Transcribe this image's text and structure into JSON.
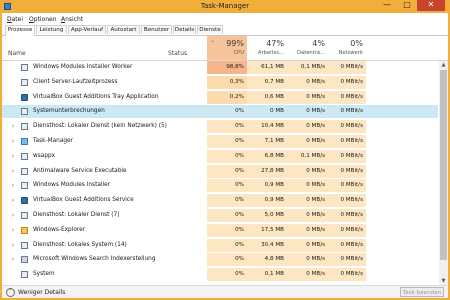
{
  "window": {
    "title": "Task-Manager",
    "min": "—",
    "max": "□",
    "close": "✕"
  },
  "menu": [
    {
      "u": "D",
      "rest": "atei"
    },
    {
      "u": "O",
      "rest": "ptionen"
    },
    {
      "u": "A",
      "rest": "nsicht"
    }
  ],
  "tabs": [
    "Prozesse",
    "Leistung",
    "App-Verlauf",
    "Autostart",
    "Benutzer",
    "Details",
    "Dienste"
  ],
  "columns": {
    "name": "Name",
    "status": "Status",
    "cpu": {
      "pct": "99%",
      "label": "CPU"
    },
    "mem": {
      "pct": "47%",
      "label": "Arbeitss..."
    },
    "disk": {
      "pct": "4%",
      "label": "Datenträ..."
    },
    "net": {
      "pct": "0%",
      "label": "Netzwerk"
    }
  },
  "processes": [
    {
      "name": "Windows Modules Installer Worker",
      "cpu": "98,8%",
      "mem": "61,1 MB",
      "disk": "0,1 MB/s",
      "net": "0 MBit/s",
      "icon": "gear-icon",
      "expand": false
    },
    {
      "name": "Client Server-Laufzeitprozess",
      "cpu": "0,3%",
      "mem": "0,7 MB",
      "disk": "0 MB/s",
      "net": "0 MBit/s",
      "icon": "process-icon",
      "expand": false
    },
    {
      "name": "VirtualBox Guest Additions Tray Application",
      "cpu": "0,2%",
      "mem": "0,6 MB",
      "disk": "0 MB/s",
      "net": "0 MBit/s",
      "icon": "virtualbox-icon",
      "expand": false
    },
    {
      "name": "Systemunterbrechungen",
      "cpu": "0%",
      "mem": "0 MB",
      "disk": "0 MB/s",
      "net": "0 MBit/s",
      "icon": "process-icon",
      "expand": false
    },
    {
      "name": "Diensthost: Lokaler Dienst (kein Netzwerk) (5)",
      "cpu": "0%",
      "mem": "10,4 MB",
      "disk": "0 MB/s",
      "net": "0 MBit/s",
      "icon": "gear-icon",
      "expand": true
    },
    {
      "name": "Task-Manager",
      "cpu": "0%",
      "mem": "7,1 MB",
      "disk": "0 MB/s",
      "net": "0 MBit/s",
      "icon": "taskmanager-icon",
      "expand": true
    },
    {
      "name": "wsappx",
      "cpu": "0%",
      "mem": "6,8 MB",
      "disk": "0,1 MB/s",
      "net": "0 MBit/s",
      "icon": "gear-icon",
      "expand": true
    },
    {
      "name": "Antimalware Service Executable",
      "cpu": "0%",
      "mem": "27,8 MB",
      "disk": "0 MB/s",
      "net": "0 MBit/s",
      "icon": "process-icon",
      "expand": true
    },
    {
      "name": "Windows Modules Installer",
      "cpu": "0%",
      "mem": "0,9 MB",
      "disk": "0 MB/s",
      "net": "0 MBit/s",
      "icon": "process-icon",
      "expand": true
    },
    {
      "name": "VirtualBox Guest Additions Service",
      "cpu": "0%",
      "mem": "0,9 MB",
      "disk": "0 MB/s",
      "net": "0 MBit/s",
      "icon": "virtualbox-icon",
      "expand": true
    },
    {
      "name": "Diensthost: Lokaler Dienst (7)",
      "cpu": "0%",
      "mem": "5,0 MB",
      "disk": "0 MB/s",
      "net": "0 MBit/s",
      "icon": "gear-icon",
      "expand": true
    },
    {
      "name": "Windows-Explorer",
      "cpu": "0%",
      "mem": "17,5 MB",
      "disk": "0 MB/s",
      "net": "0 MBit/s",
      "icon": "folder-icon",
      "expand": true
    },
    {
      "name": "Diensthost: Lokales System (14)",
      "cpu": "0%",
      "mem": "30,4 MB",
      "disk": "0 MB/s",
      "net": "0 MBit/s",
      "icon": "gear-icon",
      "expand": true
    },
    {
      "name": "Microsoft Windows Search Indexerstellung",
      "cpu": "0%",
      "mem": "4,8 MB",
      "disk": "0 MB/s",
      "net": "0 MBit/s",
      "icon": "search-icon",
      "expand": true
    },
    {
      "name": "System",
      "cpu": "0%",
      "mem": "0,1 MB",
      "disk": "0 MB/s",
      "net": "0 MBit/s",
      "icon": "process-icon",
      "expand": false
    }
  ],
  "selected_row": 3,
  "footer": {
    "fewer_details": "Weniger Details",
    "end_task": "Task beenden"
  },
  "colors": {
    "titlebar": "#f1ae3b",
    "cpu_high": "#f7b58c",
    "selection": "#cce8f3"
  }
}
